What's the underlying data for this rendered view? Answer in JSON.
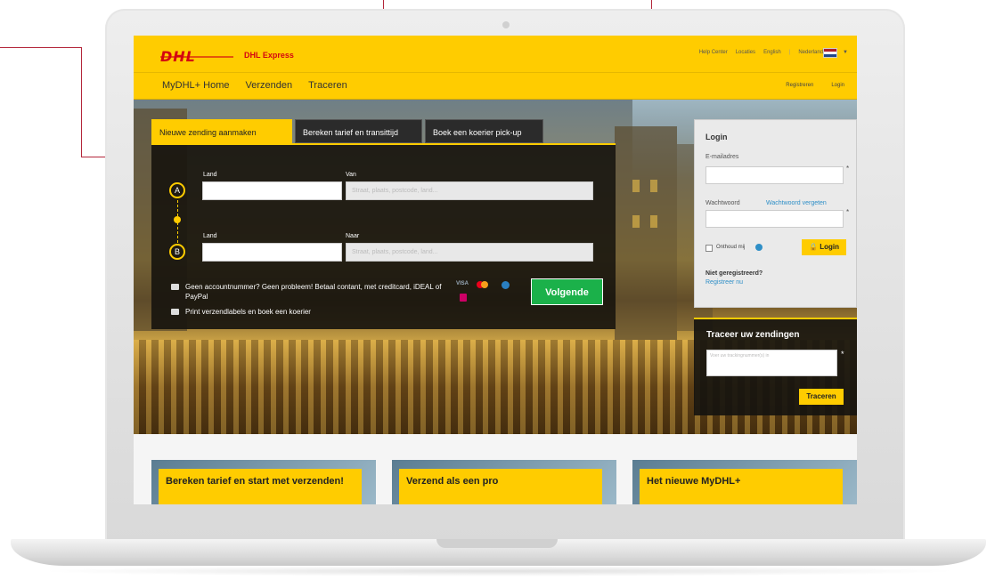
{
  "header": {
    "logo_text": "DHL",
    "brand": "DHL Express",
    "top_links": [
      "Help Center",
      "Locaties",
      "English",
      "Nederlands"
    ]
  },
  "nav": {
    "items": [
      "MyDHL+ Home",
      "Verzenden",
      "Traceren"
    ],
    "right": [
      "Registreren",
      "Login"
    ]
  },
  "tabs": [
    "Nieuwe zending aanmaken",
    "Bereken tarief en transittijd",
    "Boek een koerier pick-up"
  ],
  "form": {
    "point_a": "A",
    "point_b": "B",
    "land_label": "Land",
    "van_label": "Van",
    "naar_label": "Naar",
    "van_placeholder": "Straat, plaats, postcode, land...",
    "naar_placeholder": "Straat, plaats, postcode, land...",
    "info1": "Geen accountnummer? Geen probleem! Betaal contant, met creditcard, iDEAL of PayPal",
    "info2": "Print verzendlabels en boek een koerier",
    "payment_icons": [
      "VISA",
      "mastercard-icon",
      "paypal-icon",
      "ideal-icon"
    ],
    "next_button": "Volgende"
  },
  "login": {
    "title": "Login",
    "email_label": "E-mailadres",
    "password_label": "Wachtwoord",
    "forgot": "Wachtwoord vergeten",
    "remember": "Onthoud mij",
    "button": "Login",
    "not_registered": "Niet geregistreerd?",
    "register_link": "Registreer nu"
  },
  "track": {
    "title": "Traceer uw zendingen",
    "placeholder": "Voer uw trackingnummer(s) in",
    "button": "Traceren"
  },
  "cards": [
    "Bereken tarief en start met verzenden!",
    "Verzend als een pro",
    "Het nieuwe MyDHL+"
  ],
  "colors": {
    "dhl_yellow": "#ffcc00",
    "dhl_red": "#d40511",
    "green": "#1bb14a",
    "callout": "#b3263a"
  }
}
